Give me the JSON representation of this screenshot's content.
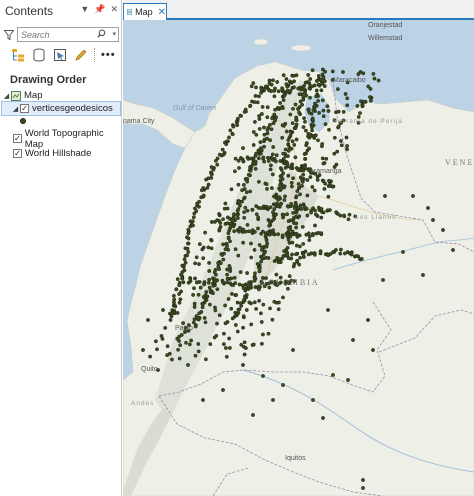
{
  "contents": {
    "title": "Contents",
    "search_placeholder": "Search",
    "section_title": "Drawing Order",
    "map_item": "Map",
    "layers": [
      {
        "label": "verticesgeodesicos",
        "checked": true,
        "selected": true
      },
      {
        "label": "World Topographic Map",
        "checked": true
      },
      {
        "label": "World Hillshade",
        "checked": true
      }
    ]
  },
  "mapview": {
    "tab_label": "Map",
    "labels": {
      "oranjestad": "Oranjestad",
      "willemstad": "Willemstad",
      "maracaibo": "Maracaibo",
      "gulf": "Gulf of Darien",
      "panama": "nama City",
      "sierra": "Serrania de Perija",
      "bucaramanga": "aramanga",
      "vene": "VENE",
      "llanos": "Los Llanos",
      "colombia": "COLOMBIA",
      "pasto": "Pasto",
      "quito": "Quito",
      "iquitos": "Iquitos",
      "andes": "Andes"
    }
  },
  "colors": {
    "accent": "#2b79bd",
    "land": "#eef0e8",
    "water": "#bcd3e6",
    "points": "#3c4a22"
  }
}
